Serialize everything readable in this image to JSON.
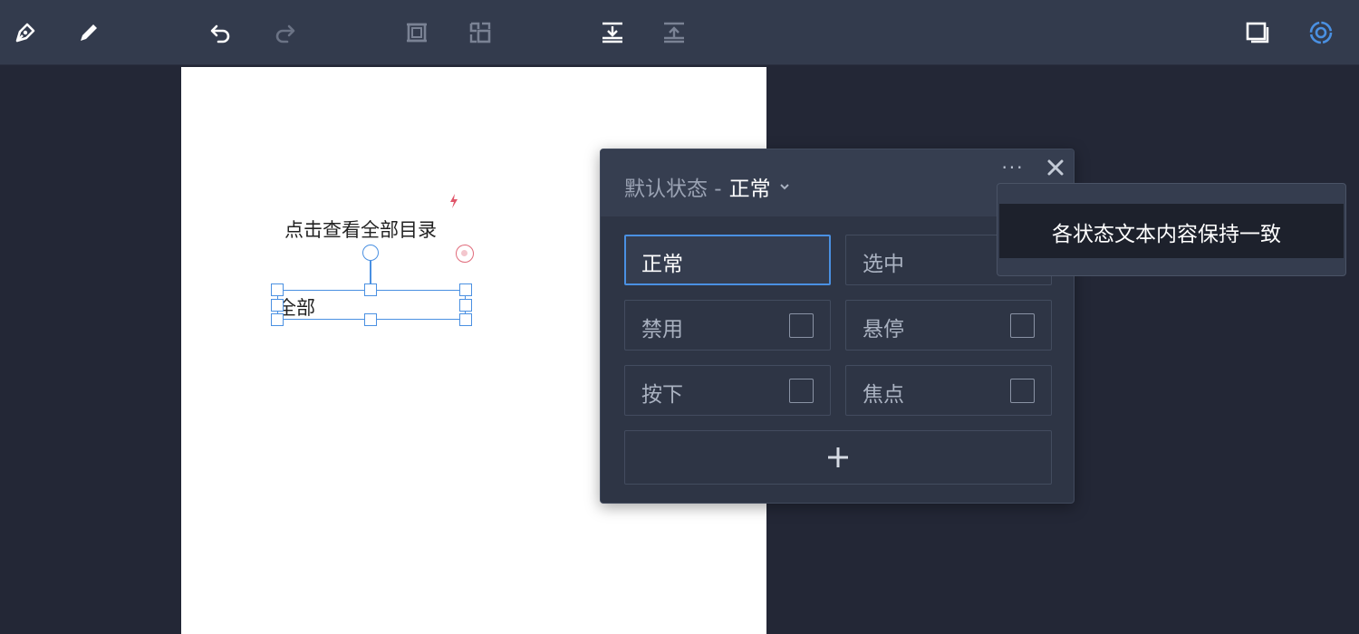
{
  "toolbar": {
    "left_tools": [
      {
        "name": "pen-tool",
        "icon": "pen-nib-icon"
      },
      {
        "name": "pencil-tool",
        "icon": "pencil-icon"
      }
    ],
    "history": [
      {
        "name": "undo",
        "icon": "undo-icon",
        "enabled": true
      },
      {
        "name": "redo",
        "icon": "redo-icon",
        "enabled": false
      }
    ],
    "right_tools": [
      {
        "name": "preview",
        "icon": "window-icon"
      },
      {
        "name": "settings",
        "icon": "target-icon",
        "accent": "#4a90e2"
      }
    ]
  },
  "canvas": {
    "heading_text": "点击查看全部目录",
    "selected_text": "全部"
  },
  "state_panel": {
    "title_prefix": "默认状态 -",
    "current_state": "正常",
    "more_label": "···",
    "states": [
      {
        "label": "正常",
        "active": true
      },
      {
        "label": "选中",
        "active": false
      },
      {
        "label": "禁用",
        "active": false
      },
      {
        "label": "悬停",
        "active": false
      },
      {
        "label": "按下",
        "active": false
      },
      {
        "label": "焦点",
        "active": false
      }
    ]
  },
  "tooltip": {
    "text": "各状态文本内容保持一致"
  },
  "colors": {
    "accent": "#4a90e2",
    "toolbar_bg": "#333b4d",
    "canvas_bg": "#232736",
    "panel_bg": "#2e3545"
  }
}
